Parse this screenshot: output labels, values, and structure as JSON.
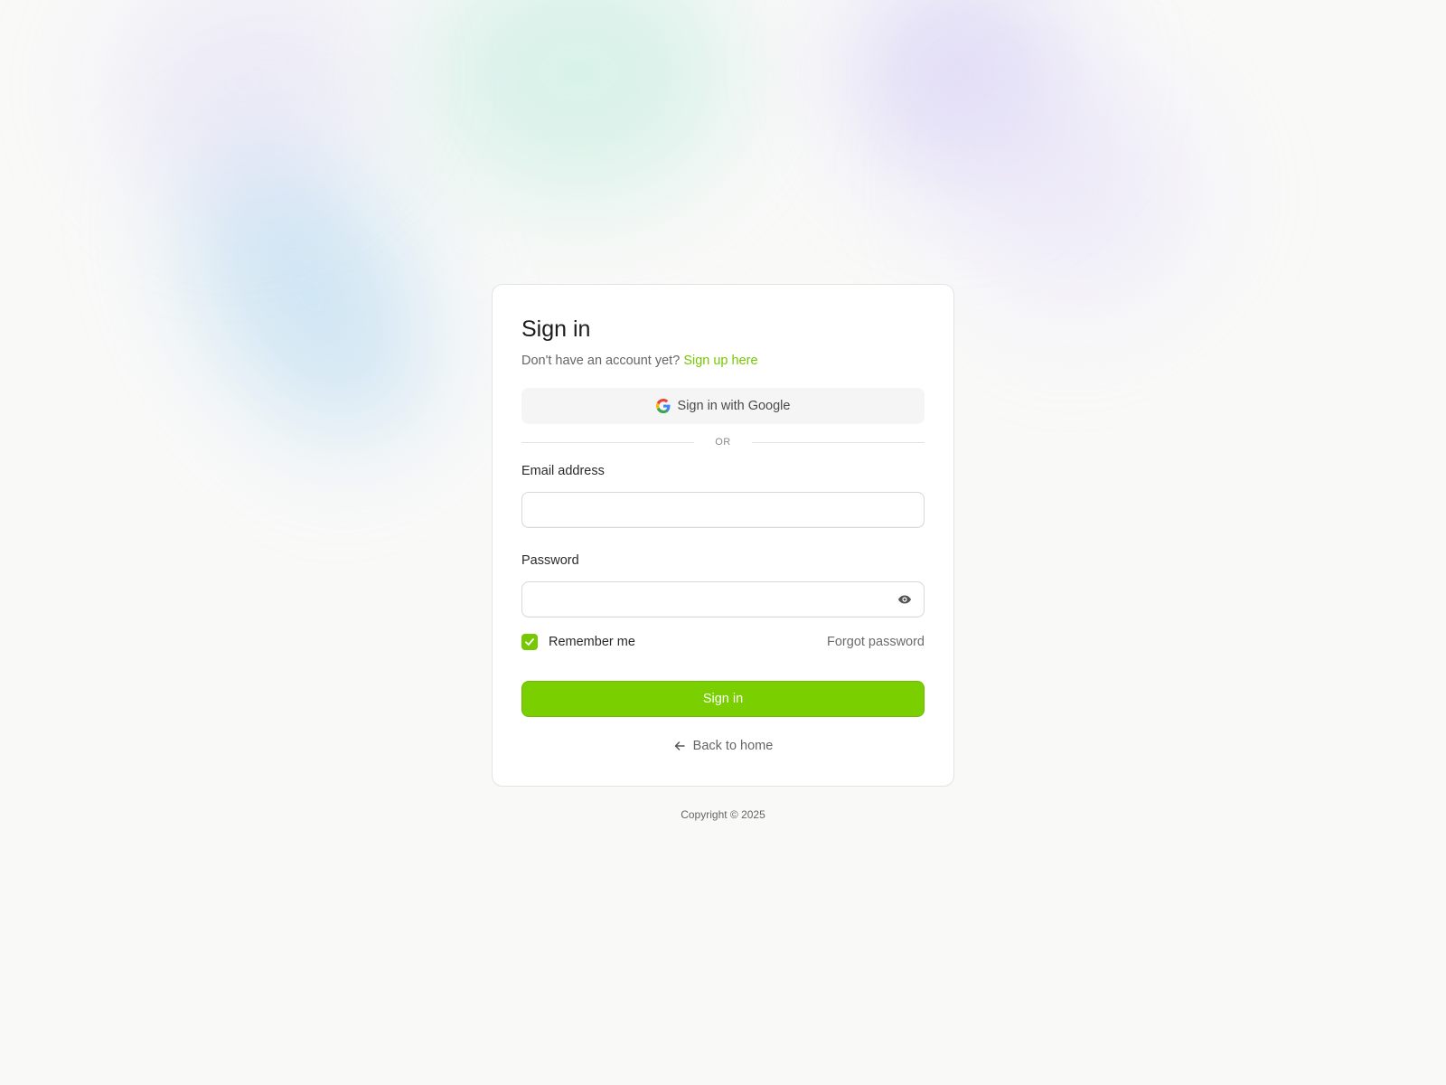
{
  "signin": {
    "title": "Sign in",
    "subtitle_prefix": "Don't have an account yet?",
    "signup_link": "Sign up here",
    "google_button": "Sign in with Google",
    "divider_text": "OR",
    "email_label": "Email address",
    "email_value": "",
    "password_label": "Password",
    "password_value": "",
    "remember_label": "Remember me",
    "remember_checked": true,
    "forgot_link": "Forgot password",
    "submit_label": "Sign in",
    "back_label": "Back to home"
  },
  "footer": {
    "copyright": "Copyright © 2025"
  },
  "icons": {
    "google": "google-icon",
    "eye": "eye-icon",
    "check": "check-icon",
    "back": "arrow-left-icon"
  },
  "colors": {
    "accent": "#7acf00",
    "link": "#76c800",
    "background": "#f9f9f8"
  }
}
